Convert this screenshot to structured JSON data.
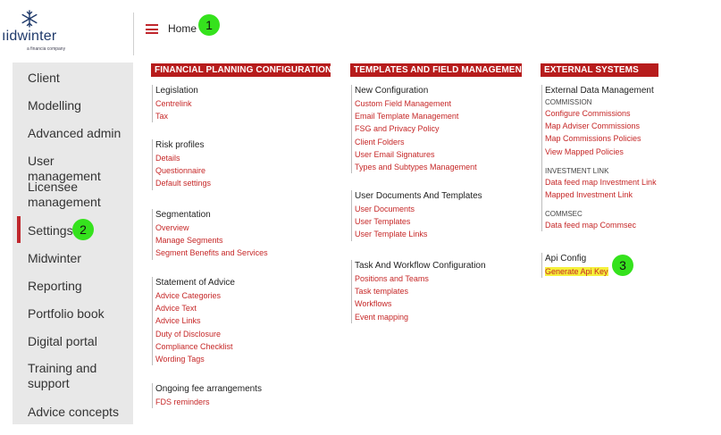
{
  "brand": {
    "name": "ıidwinter",
    "tagline": "a financia company"
  },
  "header": {
    "title": "Home"
  },
  "markers": [
    "1",
    "2",
    "3"
  ],
  "sidebar": {
    "items": [
      {
        "label": "Client"
      },
      {
        "label": "Modelling"
      },
      {
        "label": "Advanced admin"
      },
      {
        "label": "User management"
      },
      {
        "label": "Licensee management"
      },
      {
        "label": "Settings"
      },
      {
        "label": "Midwinter"
      },
      {
        "label": "Reporting"
      },
      {
        "label": "Portfolio book"
      },
      {
        "label": "Digital portal"
      },
      {
        "label": "Training and support"
      },
      {
        "label": "Advice concepts"
      }
    ]
  },
  "sections": [
    {
      "header": "FINANCIAL PLANNING CONFIGURATIONS",
      "groups": [
        {
          "title": "Legislation",
          "links": [
            "Centrelink",
            "Tax"
          ]
        },
        {
          "title": "Risk profiles",
          "links": [
            "Details",
            "Questionnaire",
            "Default settings"
          ]
        },
        {
          "title": "Segmentation",
          "links": [
            "Overview",
            "Manage Segments",
            "Segment Benefits and Services"
          ]
        },
        {
          "title": "Statement of Advice",
          "links": [
            "Advice Categories",
            "Advice Text",
            "Advice Links",
            "Duty of Disclosure",
            "Compliance Checklist",
            "Wording Tags"
          ]
        },
        {
          "title": "Ongoing fee arrangements",
          "links": [
            "FDS reminders"
          ]
        }
      ]
    },
    {
      "header": "TEMPLATES AND FIELD MANAGEMENT",
      "groups": [
        {
          "title": "New Configuration",
          "links": [
            "Custom Field Management",
            "Email Template Management",
            "FSG and Privacy Policy",
            "Client Folders",
            "User Email Signatures",
            "Types and Subtypes Management"
          ]
        },
        {
          "title": "User Documents And Templates",
          "links": [
            "User Documents",
            "User Templates",
            "User Template Links"
          ]
        },
        {
          "title": "Task And Workflow Configuration",
          "links": [
            "Positions and Teams",
            "Task templates",
            "Workflows",
            "Event mapping"
          ]
        }
      ]
    },
    {
      "header": "EXTERNAL SYSTEMS",
      "groups": [
        {
          "title": "External Data Management",
          "sub": [
            {
              "label": "COMMISSION",
              "links": [
                "Configure Commissions",
                "Map Adviser Commissions",
                "Map Commissions Policies",
                "View Mapped Policies"
              ]
            },
            {
              "label": "INVESTMENT LINK",
              "links": [
                "Data feed map Investment Link",
                "Mapped Investment Link"
              ]
            },
            {
              "label": "COMMSEC",
              "links": [
                "Data feed map Commsec"
              ]
            }
          ]
        },
        {
          "title": "Api Config",
          "links": [
            "Generate Api Key"
          ]
        }
      ]
    }
  ],
  "colors": {
    "accent": "#b71c1c",
    "link": "#c62828",
    "marker": "#35e21d",
    "highlight": "#f5f03a",
    "sidebar_bg": "#e8e8e8"
  }
}
